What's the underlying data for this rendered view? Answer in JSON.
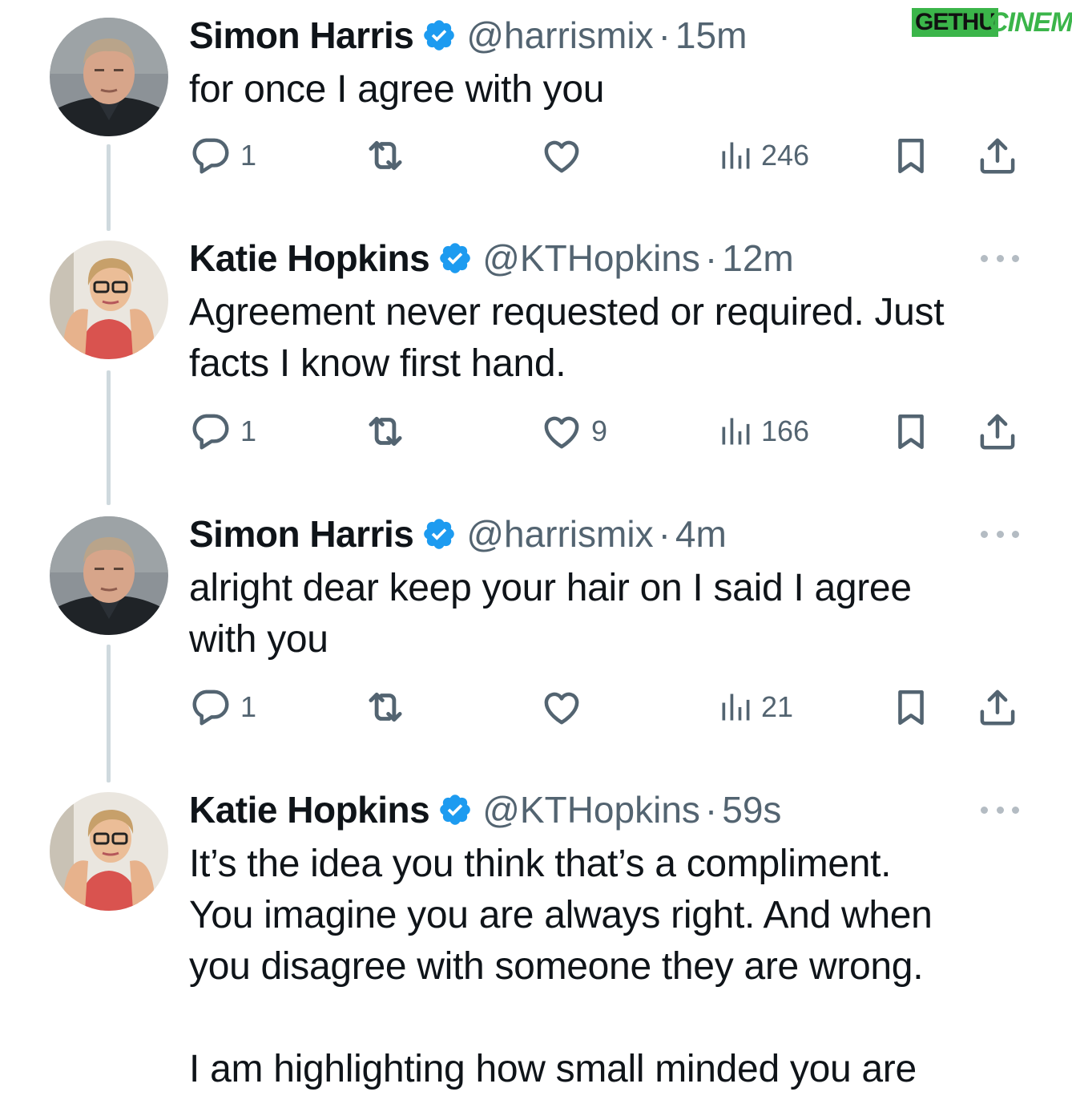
{
  "watermark": {
    "part1": "GETHU",
    "part2": "CINEMA"
  },
  "colors": {
    "verified": "#1d9bf0",
    "secondary_text": "#536471",
    "thread_line": "#cfd9de"
  },
  "tweets": [
    {
      "name": "Simon Harris",
      "handle": "@harrismix",
      "separator": "·",
      "time": "15m",
      "text": "for once I agree with you",
      "replies": "1",
      "retweets": "",
      "likes": "",
      "views": "246",
      "avatar": "man-avatar"
    },
    {
      "name": "Katie Hopkins",
      "handle": "@KTHopkins",
      "separator": "·",
      "time": "12m",
      "text": "Agreement never requested or required. Just\nfacts I know first hand.",
      "replies": "1",
      "retweets": "",
      "likes": "9",
      "views": "166",
      "avatar": "woman-avatar"
    },
    {
      "name": "Simon Harris",
      "handle": "@harrismix",
      "separator": "·",
      "time": "4m",
      "text": "alright dear keep your hair on I said I agree\nwith you",
      "replies": "1",
      "retweets": "",
      "likes": "",
      "views": "21",
      "avatar": "man-avatar"
    },
    {
      "name": "Katie Hopkins",
      "handle": "@KTHopkins",
      "separator": "·",
      "time": "59s",
      "text": "It’s the idea you think that’s a compliment.\nYou imagine you are always right. And when\nyou disagree with someone they are wrong.\n\nI am highlighting how small minded you are",
      "avatar": "woman-avatar"
    }
  ]
}
